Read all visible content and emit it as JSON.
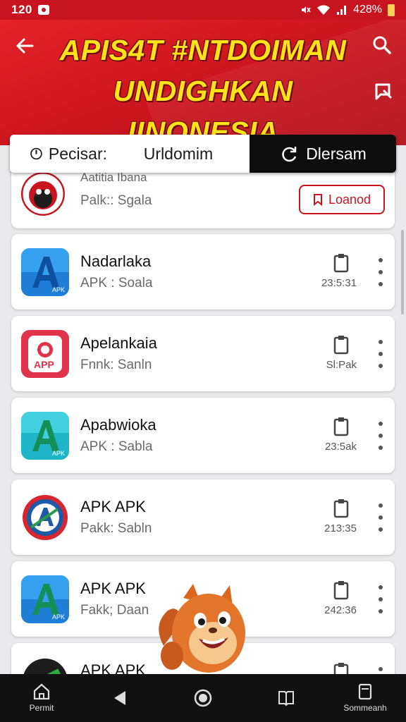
{
  "status_bar": {
    "time": "120",
    "battery": "428%"
  },
  "header": {
    "title_line1": "APIS4T #NTDOIMAN",
    "title_line2": "UNDIGHKAN IINONESIA"
  },
  "tabs": [
    {
      "label": "Pecisar:"
    },
    {
      "label": "Urldomim"
    },
    {
      "label": "Dlersam"
    }
  ],
  "top_card": {
    "name": "Aatitia Ibana",
    "sub": "Palk:: Sgala",
    "button_label": "Loanod"
  },
  "apps": [
    {
      "name": "Nadarlaka",
      "sub": "APK : Soala",
      "size": "23:5:31",
      "icon": "blue-a-icon"
    },
    {
      "name": "Apelankaia",
      "sub": "Fnnk: Sanln",
      "size": "Sl:Pak",
      "icon": "red-app-icon"
    },
    {
      "name": "Apabwioka",
      "sub": "APK : Sabla",
      "size": "23:5ak",
      "icon": "teal-a-icon"
    },
    {
      "name": "APK APK",
      "sub": "Pakk: Sabln",
      "size": "213:35",
      "icon": "badge-a-icon"
    },
    {
      "name": "APK APK",
      "sub": "Fakk; Daan",
      "size": "242:36",
      "icon": "blue-a-icon"
    },
    {
      "name": "APK APK",
      "sub": "",
      "size": "",
      "icon": "badge-green-icon"
    }
  ],
  "bottom_nav": {
    "left_label": "Permit",
    "right_label": "Sommeanh"
  },
  "colors": {
    "brand_red": "#c8141e",
    "title_yellow": "#ffe21a",
    "tab_active": "#0d0d0d"
  }
}
